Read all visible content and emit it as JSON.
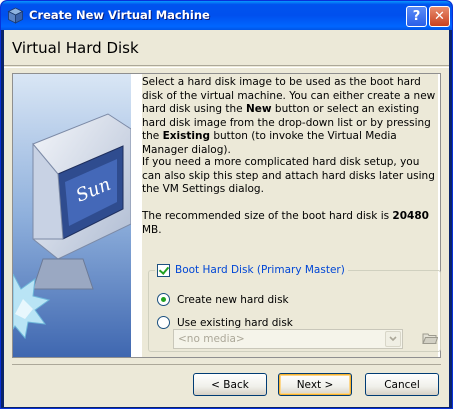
{
  "window": {
    "title": "Create New Virtual Machine"
  },
  "titlebar": {
    "help_label": "?",
    "close_label": "✕"
  },
  "header": {
    "title": "Virtual Hard Disk"
  },
  "content": {
    "p1_a": "Select a hard disk image to be used as the boot hard disk of the virtual machine. You can either create a new hard disk using the ",
    "p1_new": "New",
    "p1_b": " button or select an existing hard disk image from the drop-down list or by pressing the ",
    "p1_existing": "Existing",
    "p1_c": " button (to invoke the Virtual Media Manager dialog).",
    "p2": "If you need a more complicated hard disk setup, you can also skip this step and attach hard disks later using the VM Settings dialog.",
    "p3_a": "The recommended size of the boot hard disk is ",
    "p3_size": "20480",
    "p3_b": " MB."
  },
  "boot_disk": {
    "checkbox_label": "Boot Hard Disk (Primary Master)",
    "checked": true,
    "options": [
      {
        "label": "Create new hard disk",
        "selected": true
      },
      {
        "label": "Use existing hard disk",
        "selected": false
      }
    ],
    "media_select_value": "<no media>"
  },
  "buttons": {
    "back": "< Back",
    "next": "Next >",
    "cancel": "Cancel"
  },
  "colors": {
    "title_bar": "#0050ee",
    "dialog_bg": "#ece9d8",
    "link_blue": "#0046d5",
    "close_red": "#c9411f"
  }
}
